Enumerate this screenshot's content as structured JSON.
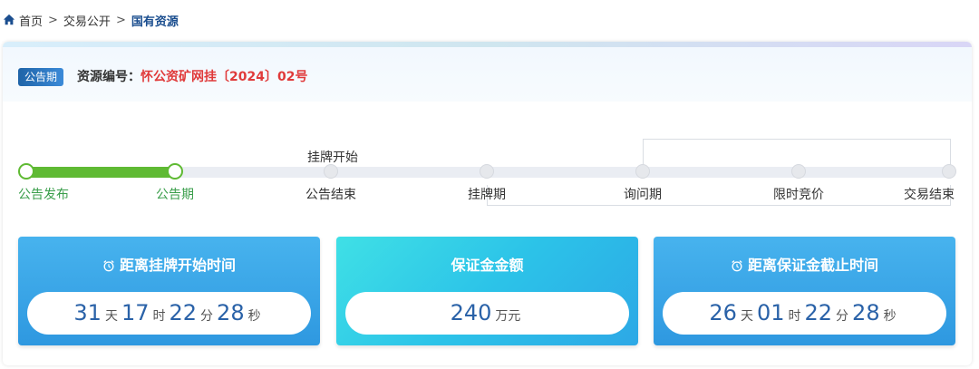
{
  "breadcrumb": {
    "home": "首页",
    "separator": ">",
    "middle": "交易公开",
    "current": "国有资源"
  },
  "header": {
    "phase_badge": "公告期",
    "resource_label": "资源编号：",
    "resource_value": "怀公资矿网挂〔2024〕02号"
  },
  "timeline": {
    "above_label": "挂牌开始",
    "steps": [
      {
        "label": "公告发布",
        "state": "done"
      },
      {
        "label": "公告期",
        "state": "current"
      },
      {
        "label": "公告结束",
        "state": "pending"
      },
      {
        "label": "挂牌期",
        "state": "pending"
      },
      {
        "label": "询问期",
        "state": "pending"
      },
      {
        "label": "限时竞价",
        "state": "pending"
      },
      {
        "label": "交易结束",
        "state": "pending"
      }
    ]
  },
  "boxes": [
    {
      "title": "距离挂牌开始时间",
      "icon": "alarm-clock-icon",
      "days": "31",
      "days_unit": "天",
      "hours": "17",
      "hours_unit": "时",
      "minutes": "22",
      "minutes_unit": "分",
      "seconds": "28",
      "seconds_unit": "秒"
    },
    {
      "title": "保证金金额",
      "amount": "240",
      "amount_unit": "万元"
    },
    {
      "title": "距离保证金截止时间",
      "icon": "alarm-clock-icon",
      "days": "26",
      "days_unit": "天",
      "hours": "01",
      "hours_unit": "时",
      "minutes": "22",
      "minutes_unit": "分",
      "seconds": "28",
      "seconds_unit": "秒"
    }
  ],
  "colors": {
    "accent_green": "#5fba33",
    "accent_red": "#e03a3a",
    "accent_blue": "#2a62a8"
  }
}
